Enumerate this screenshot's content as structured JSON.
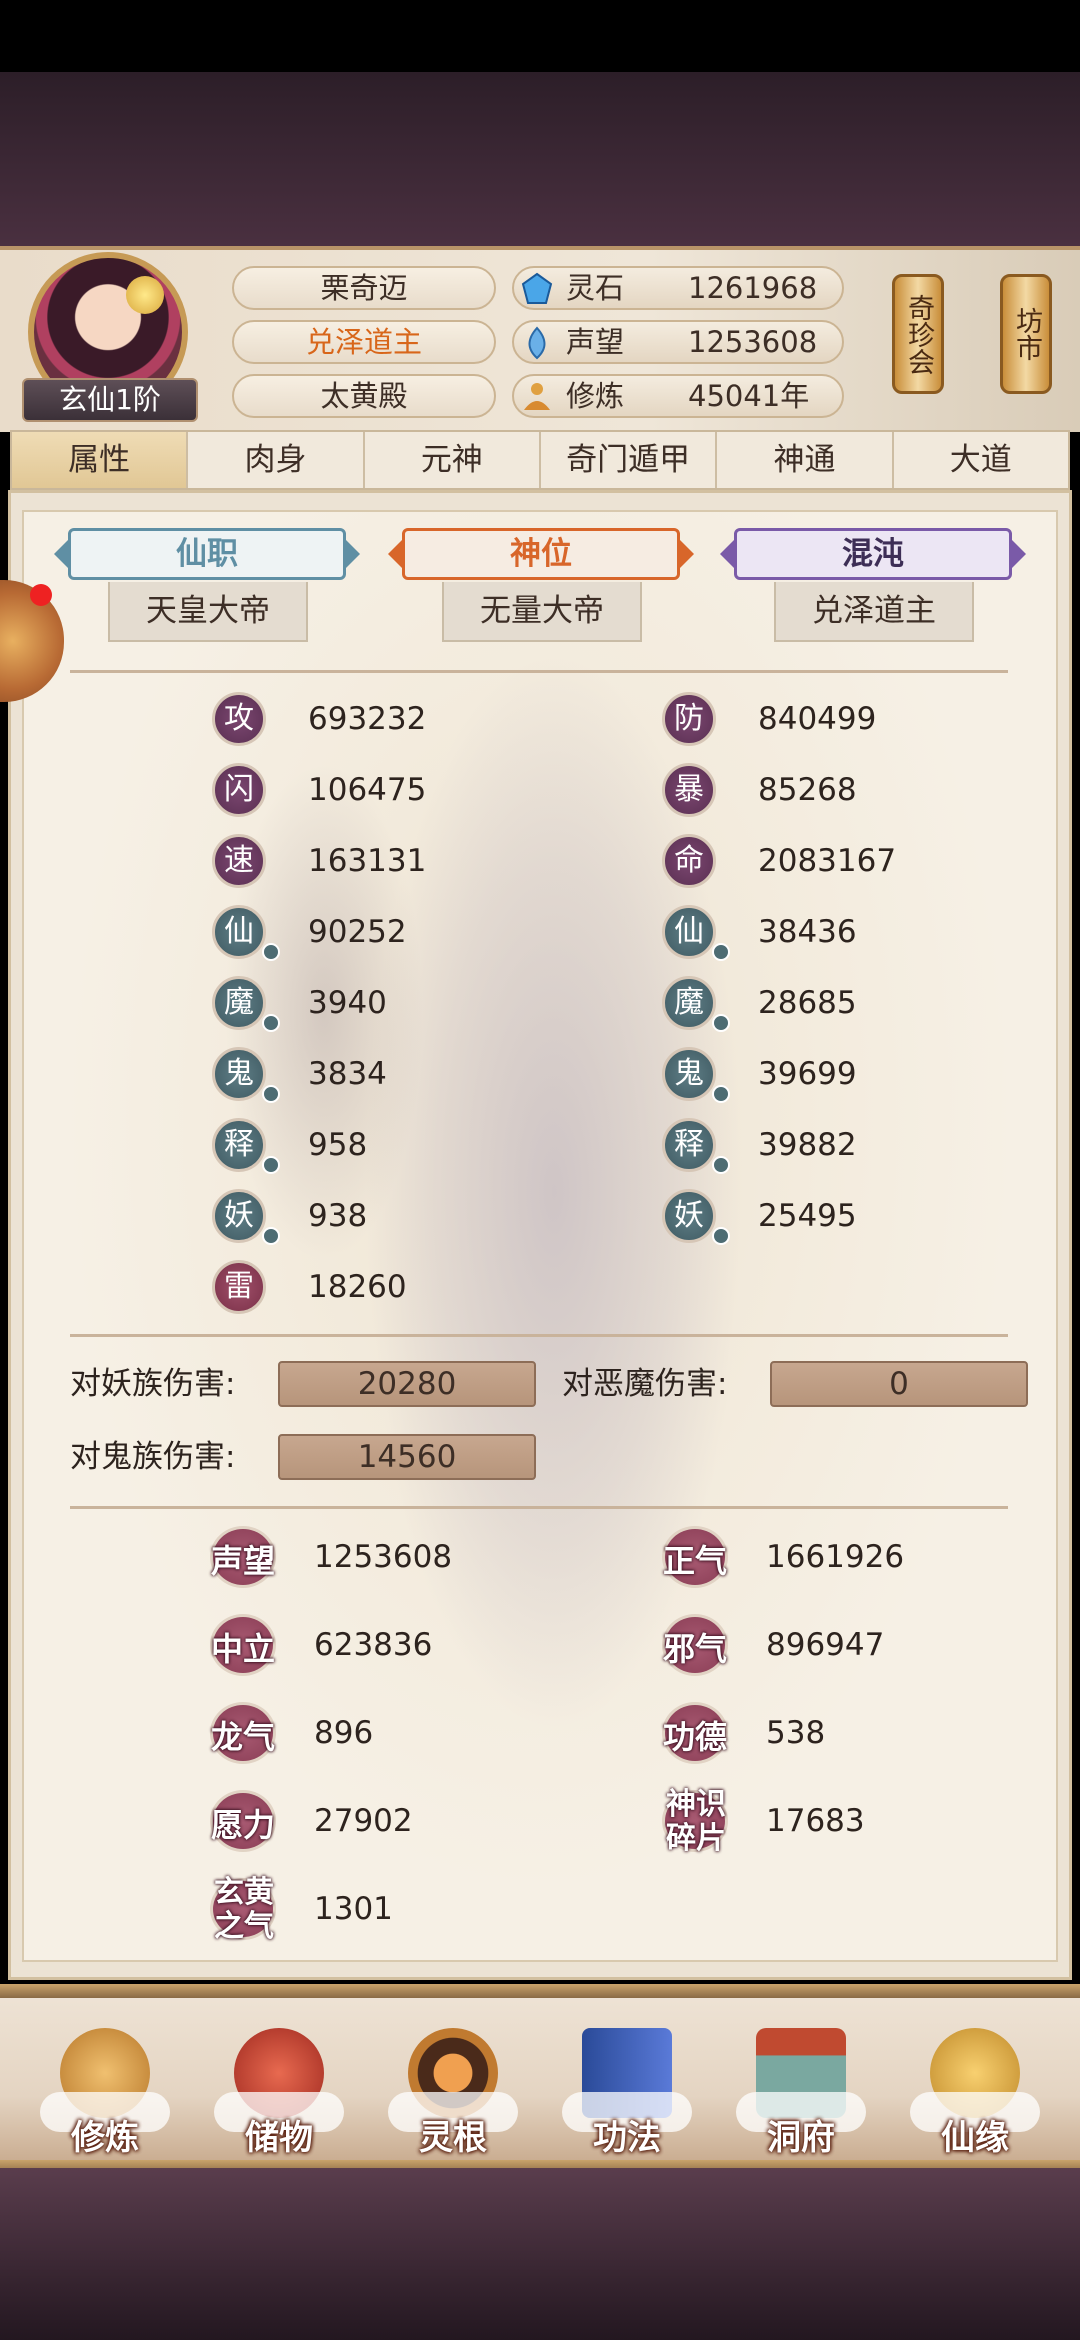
{
  "profile": {
    "rank": "玄仙1阶",
    "name": "栗奇迈",
    "title": "兑泽道主",
    "sect": "太黄殿"
  },
  "currencies": [
    {
      "icon": "spirit-stone-icon",
      "label": "灵石",
      "value": "1261968"
    },
    {
      "icon": "prestige-icon",
      "label": "声望",
      "value": "1253608"
    },
    {
      "icon": "cultivation-icon",
      "label": "修炼",
      "value": "45041年"
    }
  ],
  "shortcuts": {
    "treasure_fair": "奇珍会",
    "market": "坊市"
  },
  "tabs": [
    "属性",
    "肉身",
    "元神",
    "奇门遁甲",
    "神通",
    "大道"
  ],
  "badges": [
    {
      "label": "仙职",
      "value": "天皇大帝",
      "color": "#5f8fa4"
    },
    {
      "label": "神位",
      "value": "无量大帝",
      "color": "#d8662a"
    },
    {
      "label": "混沌",
      "value": "兑泽道主",
      "color": "#7a5aa8"
    }
  ],
  "stats_left": [
    {
      "char": "攻",
      "value": "693232"
    },
    {
      "char": "闪",
      "value": "106475"
    },
    {
      "char": "速",
      "value": "163131"
    },
    {
      "char": "仙",
      "value": "90252"
    },
    {
      "char": "魔",
      "value": "3940"
    },
    {
      "char": "鬼",
      "value": "3834"
    },
    {
      "char": "释",
      "value": "958"
    },
    {
      "char": "妖",
      "value": "938"
    },
    {
      "char": "雷",
      "value": "18260"
    }
  ],
  "stats_right": [
    {
      "char": "防",
      "value": "840499"
    },
    {
      "char": "暴",
      "value": "85268"
    },
    {
      "char": "命",
      "value": "2083167"
    },
    {
      "char": "仙",
      "value": "38436"
    },
    {
      "char": "魔",
      "value": "28685"
    },
    {
      "char": "鬼",
      "value": "39699"
    },
    {
      "char": "释",
      "value": "39882"
    },
    {
      "char": "妖",
      "value": "25495"
    }
  ],
  "damage": [
    {
      "label": "对妖族伤害:",
      "value": "20280"
    },
    {
      "label": "对恶魔伤害:",
      "value": "0"
    },
    {
      "label": "对鬼族伤害:",
      "value": "14560"
    }
  ],
  "resources_left": [
    {
      "label": "声望",
      "value": "1253608"
    },
    {
      "label": "中立",
      "value": "623836"
    },
    {
      "label": "龙气",
      "value": "896"
    },
    {
      "label": "愿力",
      "value": "27902"
    },
    {
      "label": "玄黄之气",
      "value": "1301"
    }
  ],
  "resources_right": [
    {
      "label": "正气",
      "value": "1661926"
    },
    {
      "label": "邪气",
      "value": "896947"
    },
    {
      "label": "功德",
      "value": "538"
    },
    {
      "label": "神识碎片",
      "value": "17683"
    }
  ],
  "nav": [
    {
      "label": "修炼",
      "icon": "cultivate-icon",
      "color": "#d89a3a"
    },
    {
      "label": "储物",
      "icon": "storage-bag-icon",
      "color": "#c84a3a"
    },
    {
      "label": "灵根",
      "icon": "spirit-root-icon",
      "color": "#b8702a"
    },
    {
      "label": "功法",
      "icon": "technique-book-icon",
      "color": "#4a6ab8"
    },
    {
      "label": "洞府",
      "icon": "cave-dwelling-icon",
      "color": "#a88a5a"
    },
    {
      "label": "仙缘",
      "icon": "gourd-icon",
      "color": "#d8aa4a"
    }
  ]
}
